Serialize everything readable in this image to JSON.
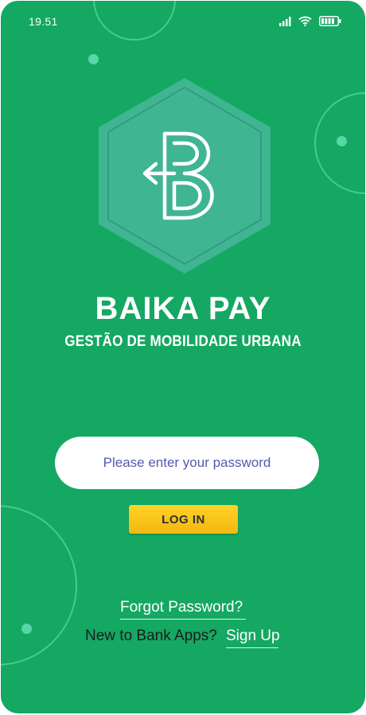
{
  "status_bar": {
    "time": "19.51"
  },
  "brand": {
    "title": "BAIKA PAY",
    "subtitle": "GESTÃO DE MOBILIDADE URBANA"
  },
  "login_form": {
    "password_placeholder": "Please enter your password",
    "login_label": "LOG IN"
  },
  "links": {
    "forgot_password": "Forgot Password?",
    "new_user_prompt": "New to Bank Apps?",
    "sign_up": "Sign Up"
  },
  "colors": {
    "background": "#14a862",
    "logo_hexagon": "#3fb592",
    "button": "#fcc81e",
    "placeholder_text": "#5559b0"
  },
  "icons": [
    "cellular-signal-icon",
    "wifi-icon",
    "battery-icon",
    "baika-logo-icon"
  ]
}
